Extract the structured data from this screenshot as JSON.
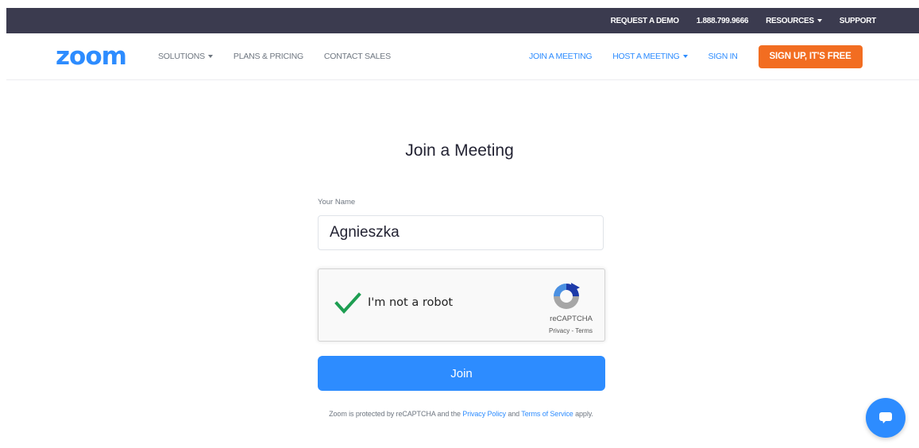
{
  "topbar": {
    "request_demo": "REQUEST A DEMO",
    "phone": "1.888.799.9666",
    "resources": "RESOURCES",
    "support": "SUPPORT"
  },
  "header": {
    "logo": "zoom",
    "nav_left": [
      "SOLUTIONS",
      "PLANS & PRICING",
      "CONTACT SALES"
    ],
    "nav_right": {
      "join_meeting": "JOIN A MEETING",
      "host_meeting": "HOST A MEETING",
      "sign_in": "SIGN IN",
      "sign_up": "SIGN UP, IT'S FREE"
    }
  },
  "main": {
    "title": "Join a Meeting",
    "name_label": "Your Name",
    "name_value": "Agnieszka",
    "recaptcha": {
      "label": "I'm not a robot",
      "brand": "reCAPTCHA",
      "terms": "Privacy - Terms",
      "checked": true
    },
    "join_label": "Join",
    "footnote": {
      "prefix": "Zoom is protected by reCAPTCHA and the",
      "privacy_link": "Privacy Policy",
      "and": "and",
      "terms_link": "Terms of Service",
      "suffix": "apply."
    }
  },
  "icons": {
    "checkmark": "checkmark-icon",
    "recaptcha": "recaptcha-logo-icon",
    "chat": "chat-icon"
  },
  "colors": {
    "brand_blue": "#2d8cff",
    "signup_orange": "#f26d21",
    "topbar_bg": "#3b3b4f",
    "check_green": "#1e9e52"
  }
}
